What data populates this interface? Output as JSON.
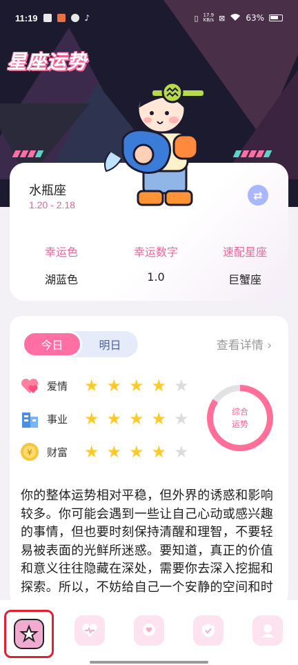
{
  "status_bar": {
    "time": "11:19",
    "net_speed_value": "17.9",
    "net_speed_unit": "KB/s",
    "battery": "63%"
  },
  "header": {
    "title": "星座运势"
  },
  "sign_card": {
    "name": "水瓶座",
    "date_range": "1.20 - 2.18",
    "switch_icon": "swap-icon",
    "attributes": [
      {
        "label": "幸运色",
        "value": "湖蓝色"
      },
      {
        "label": "幸运数字",
        "value": "1.0"
      },
      {
        "label": "速配星座",
        "value": "巨蟹座"
      }
    ]
  },
  "fortune_card": {
    "tabs": [
      {
        "label": "今日",
        "active": true
      },
      {
        "label": "明日",
        "active": false
      }
    ],
    "detail_link": "查看详情",
    "ratings": [
      {
        "label": "爱情",
        "icon": "heart-icon",
        "stars": 4,
        "max": 5
      },
      {
        "label": "事业",
        "icon": "building-icon",
        "stars": 4,
        "max": 5
      },
      {
        "label": "财富",
        "icon": "coin-icon",
        "stars": 4,
        "max": 5
      }
    ],
    "overall": {
      "line1": "综合",
      "line2": "运势",
      "fraction": 0.85
    },
    "text": "你的整体运势相对平稳，但外界的诱惑和影响较多。你可能会遇到一些让自己心动或感兴趣的事情，但也要时刻保持清醒和理智，不要轻易被表面的光鲜所迷惑。要知道，真正的价值和意义往往隐藏在深处，需要你去深入挖掘和探索。所以，不妨给自己一个安静的空间和时"
  },
  "bottom_nav": {
    "items": [
      {
        "icon": "star-icon",
        "active": true
      },
      {
        "icon": "heart-pulse-icon",
        "active": false
      },
      {
        "icon": "chat-heart-icon",
        "active": false
      },
      {
        "icon": "shield-check-icon",
        "active": false
      },
      {
        "icon": "profile-icon",
        "active": false
      }
    ]
  },
  "colors": {
    "accent_pink": "#ff6fa3",
    "hero_bg": "#1c1a2e",
    "star_on": "#ffc928",
    "star_off": "#dcdcdc"
  }
}
